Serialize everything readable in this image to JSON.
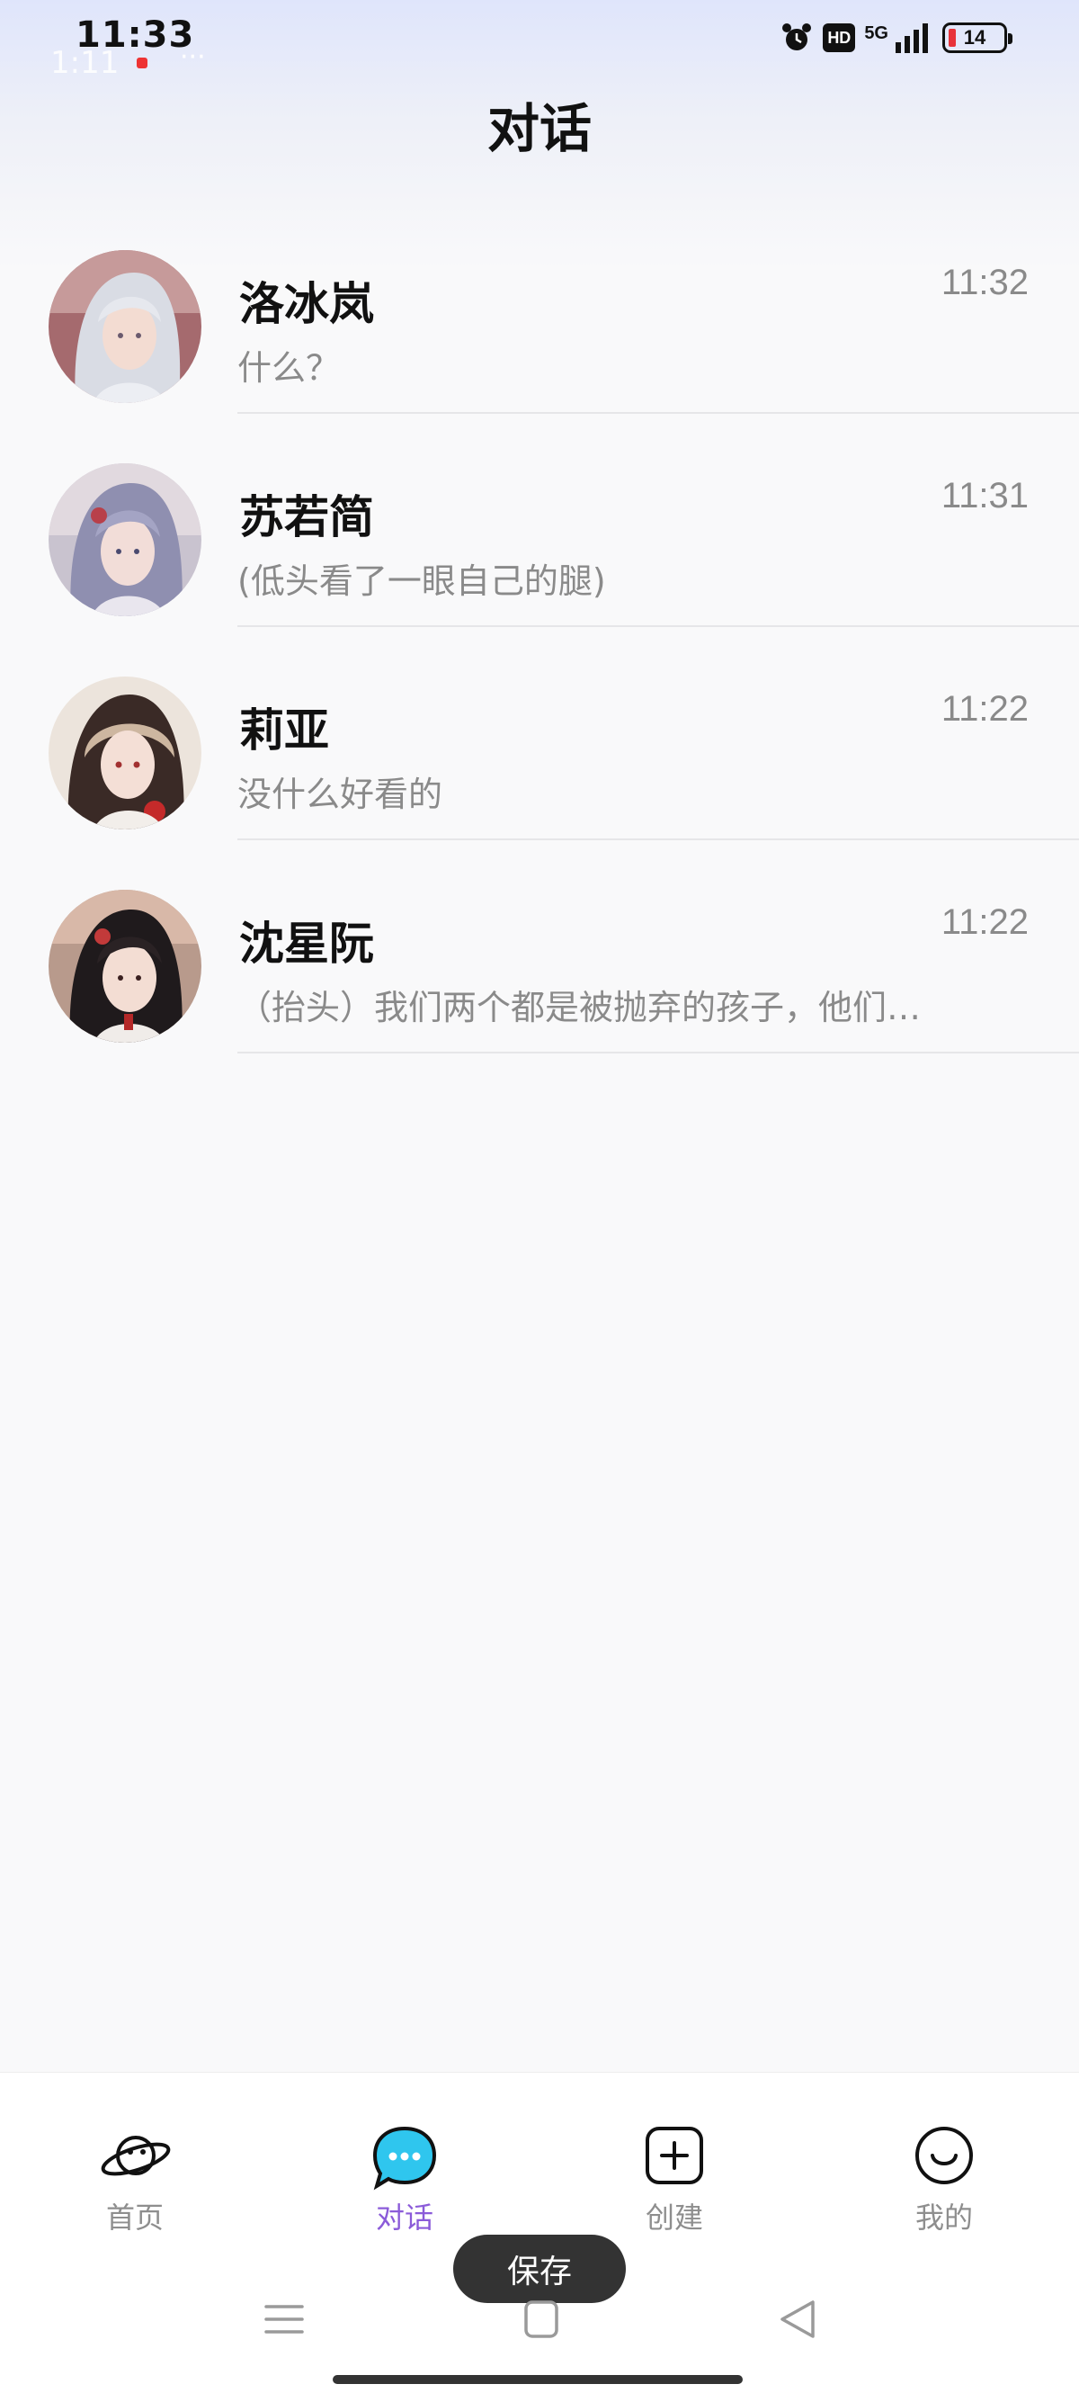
{
  "status_bar": {
    "time": "11:33",
    "ghost_time": "1:11",
    "ghost_dots": "···",
    "hd_badge": "HD",
    "network": "5G",
    "battery_level": "14",
    "battery_low_color": "#e8333a"
  },
  "header": {
    "title": "对话"
  },
  "conversations": [
    {
      "name": "洛冰岚",
      "time": "11:32",
      "preview": "什么？",
      "avatar": "avatar-silver-hair"
    },
    {
      "name": "苏若简",
      "time": "11:31",
      "preview": "(低头看了一眼自己的腿)",
      "avatar": "avatar-lavender-hair"
    },
    {
      "name": "莉亚",
      "time": "11:22",
      "preview": "没什么好看的",
      "avatar": "avatar-blonde-hair"
    },
    {
      "name": "沈星阮",
      "time": "11:22",
      "preview": "（抬头）我们两个都是被抛弃的孩子，他们…",
      "avatar": "avatar-dark-hair"
    }
  ],
  "bottom_nav": {
    "active_color": "#8b5bd9",
    "tabs": [
      {
        "label": "首页",
        "icon": "planet-icon",
        "active": false
      },
      {
        "label": "对话",
        "icon": "chat-bubble-icon",
        "active": true
      },
      {
        "label": "创建",
        "icon": "plus-square-icon",
        "active": false
      },
      {
        "label": "我的",
        "icon": "smile-face-icon",
        "active": false
      }
    ]
  },
  "toast": {
    "label": "保存"
  },
  "system_nav": {
    "menu_icon": "menu-icon",
    "home_icon": "home-square-icon",
    "back_icon": "back-triangle-icon"
  }
}
